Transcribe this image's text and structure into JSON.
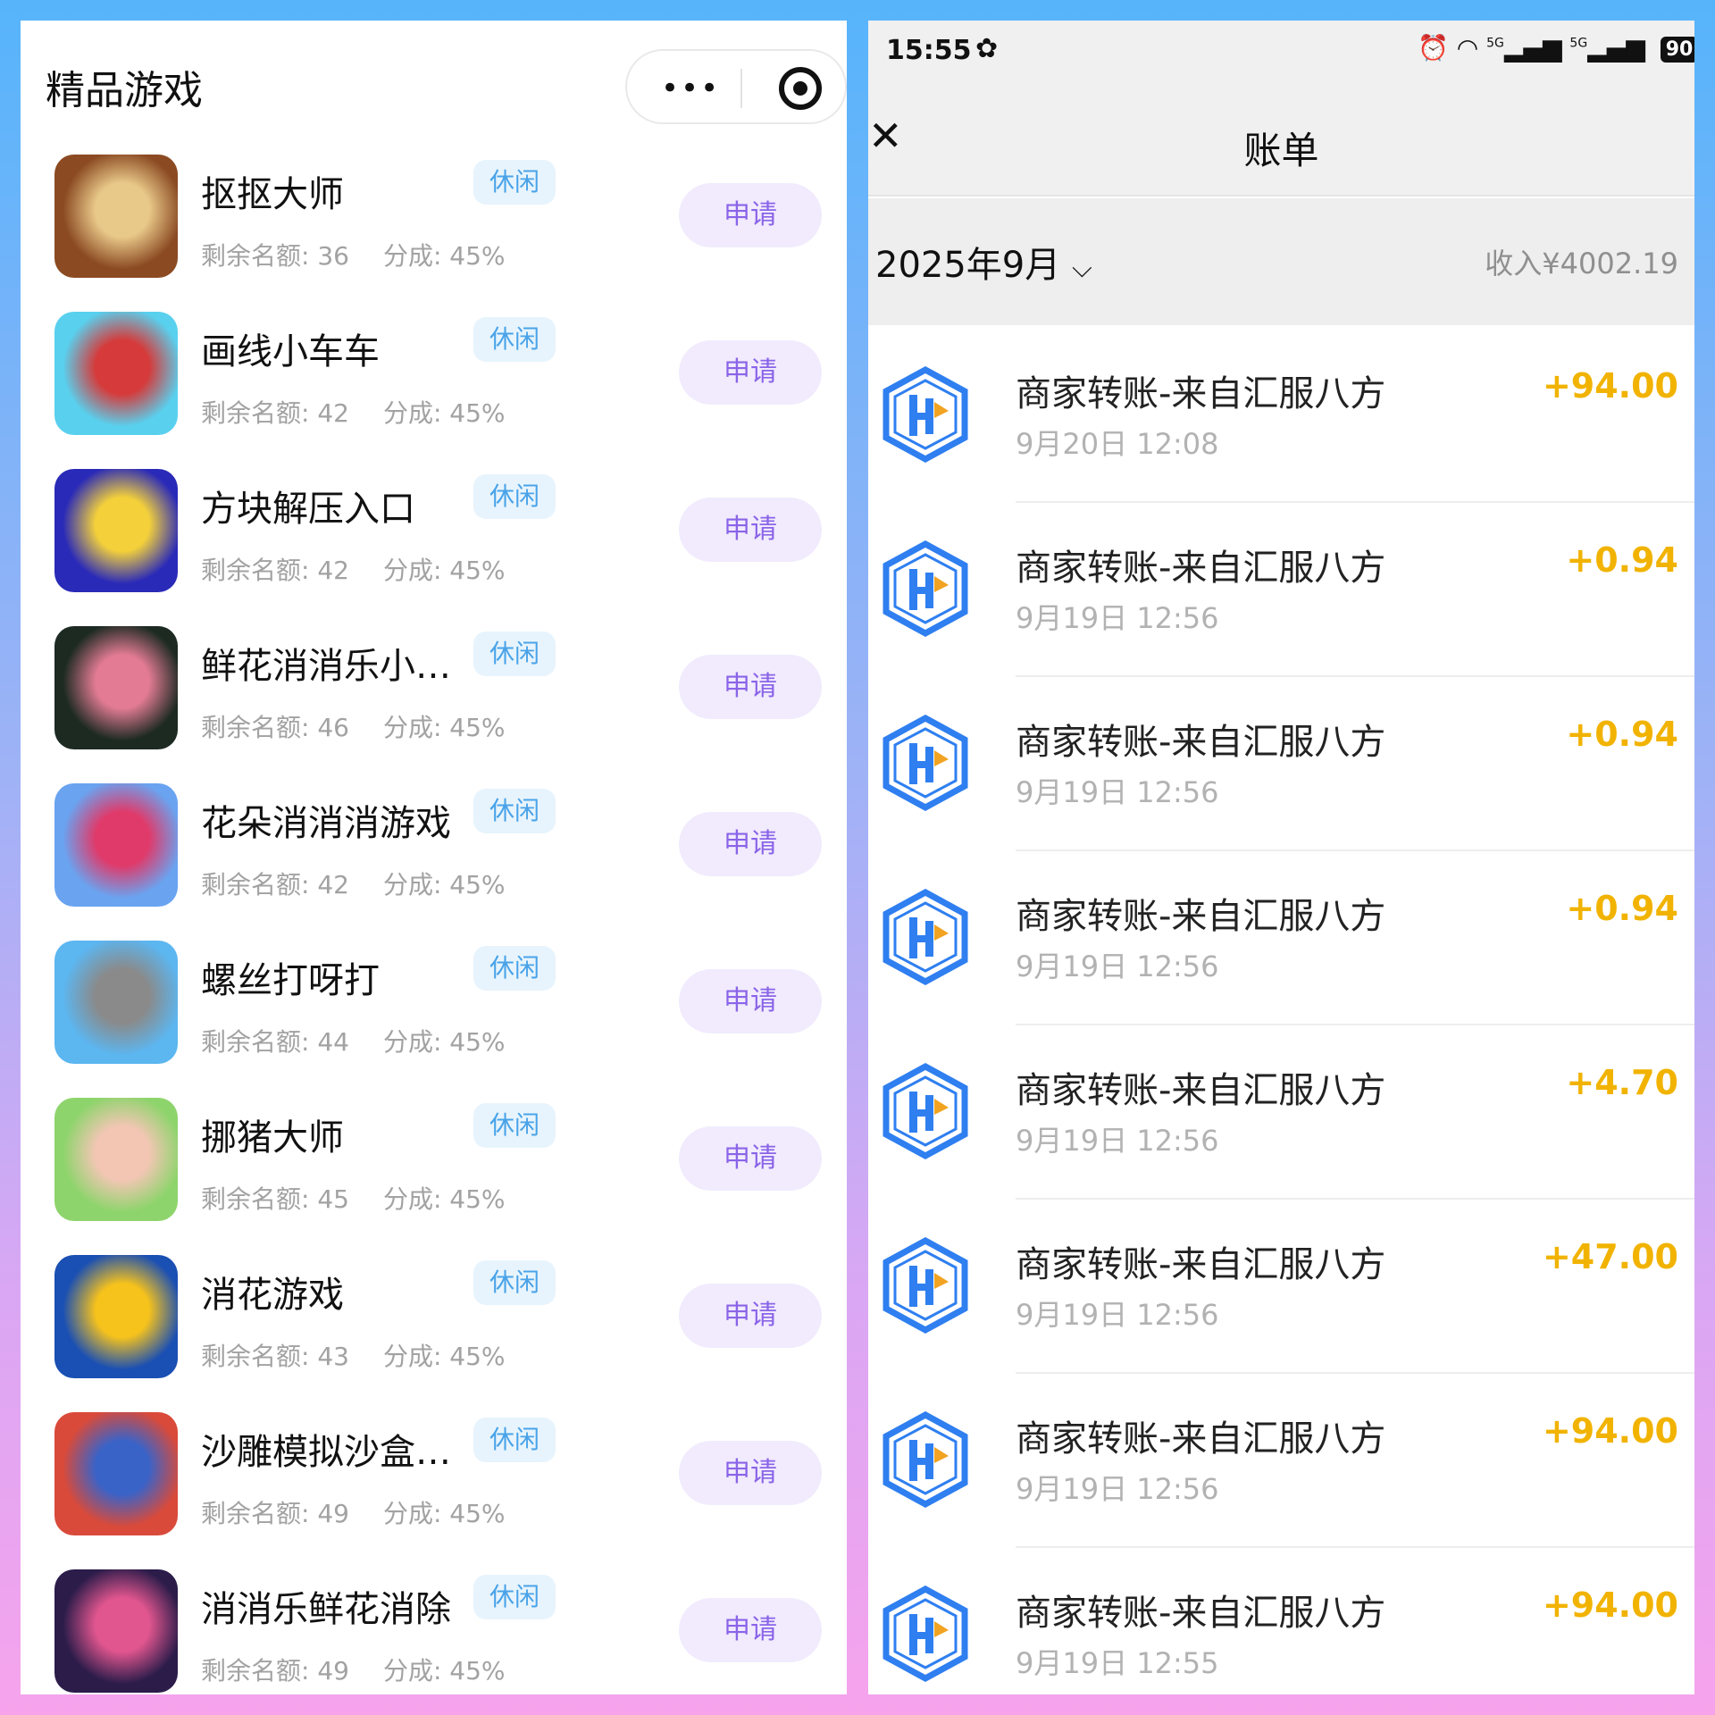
{
  "left_panel": {
    "title": "精品游戏",
    "capsule": {
      "more_icon": "more-dots-icon",
      "close_icon": "target-circle-icon"
    },
    "games": [
      {
        "name": "抠抠大师",
        "tag": "休闲",
        "remaining": "剩余名额: 36",
        "share": "分成: 45%",
        "button": "申请",
        "icon": "cookie-tin-icon",
        "icon_colors": [
          "#8b4a22",
          "#e9c98a"
        ]
      },
      {
        "name": "画线小车车",
        "tag": "休闲",
        "remaining": "剩余名额: 42",
        "share": "分成: 45%",
        "button": "申请",
        "icon": "red-car-icon",
        "icon_colors": [
          "#59d0ee",
          "#d63a3a"
        ]
      },
      {
        "name": "方块解压入口",
        "tag": "休闲",
        "remaining": "剩余名额: 42",
        "share": "分成: 45%",
        "button": "申请",
        "icon": "block-puzzle-icon",
        "icon_colors": [
          "#2a2ab8",
          "#f4d13a"
        ]
      },
      {
        "name": "鲜花消消乐小…",
        "tag": "休闲",
        "remaining": "剩余名额: 46",
        "share": "分成: 45%",
        "button": "申请",
        "icon": "roses-icon",
        "icon_colors": [
          "#1c2a22",
          "#e27b93"
        ]
      },
      {
        "name": "花朵消消消游戏",
        "tag": "休闲",
        "remaining": "剩余名额: 42",
        "share": "分成: 45%",
        "button": "申请",
        "icon": "butterfly-rose-icon",
        "icon_colors": [
          "#6aa3f0",
          "#e03a6a"
        ]
      },
      {
        "name": "螺丝打呀打",
        "tag": "休闲",
        "remaining": "剩余名额: 44",
        "share": "分成: 45%",
        "button": "申请",
        "icon": "screw-statue-icon",
        "icon_colors": [
          "#5cb6f0",
          "#8a8a8a"
        ]
      },
      {
        "name": "挪猪大师",
        "tag": "休闲",
        "remaining": "剩余名额: 45",
        "share": "分成: 45%",
        "button": "申请",
        "icon": "pigs-icon",
        "icon_colors": [
          "#8ed46c",
          "#f3c6b4"
        ]
      },
      {
        "name": "消花游戏",
        "tag": "休闲",
        "remaining": "剩余名额: 43",
        "share": "分成: 45%",
        "button": "申请",
        "icon": "yellow-flower-icon",
        "icon_colors": [
          "#1a4fb3",
          "#f6c21c"
        ]
      },
      {
        "name": "沙雕模拟沙盒…",
        "tag": "休闲",
        "remaining": "剩余名额: 49",
        "share": "分成: 45%",
        "button": "申请",
        "icon": "sandbox-characters-icon",
        "icon_colors": [
          "#d94a3a",
          "#3a63c8"
        ]
      },
      {
        "name": "消消乐鲜花消除",
        "tag": "休闲",
        "remaining": "剩余名额: 49",
        "share": "分成: 45%",
        "button": "申请",
        "icon": "lotus-icon",
        "icon_colors": [
          "#2b1c4a",
          "#e2568f"
        ]
      }
    ]
  },
  "right_panel": {
    "status": {
      "time": "15:55",
      "signal1": "5G",
      "signal2": "5G",
      "battery": "90"
    },
    "title": "账单",
    "month": "2025年9月",
    "income": "收入¥4002.19",
    "logo_colors": [
      "#2f7ff0",
      "#f2a321"
    ],
    "transactions": [
      {
        "title": "商家转账-来自汇服八方",
        "time": "9月20日 12:08",
        "amount": "+94.00"
      },
      {
        "title": "商家转账-来自汇服八方",
        "time": "9月19日 12:56",
        "amount": "+0.94"
      },
      {
        "title": "商家转账-来自汇服八方",
        "time": "9月19日 12:56",
        "amount": "+0.94"
      },
      {
        "title": "商家转账-来自汇服八方",
        "time": "9月19日 12:56",
        "amount": "+0.94"
      },
      {
        "title": "商家转账-来自汇服八方",
        "time": "9月19日 12:56",
        "amount": "+4.70"
      },
      {
        "title": "商家转账-来自汇服八方",
        "time": "9月19日 12:56",
        "amount": "+47.00"
      },
      {
        "title": "商家转账-来自汇服八方",
        "time": "9月19日 12:56",
        "amount": "+94.00"
      },
      {
        "title": "商家转账-来自汇服八方",
        "time": "9月19日 12:55",
        "amount": "+94.00"
      }
    ]
  }
}
